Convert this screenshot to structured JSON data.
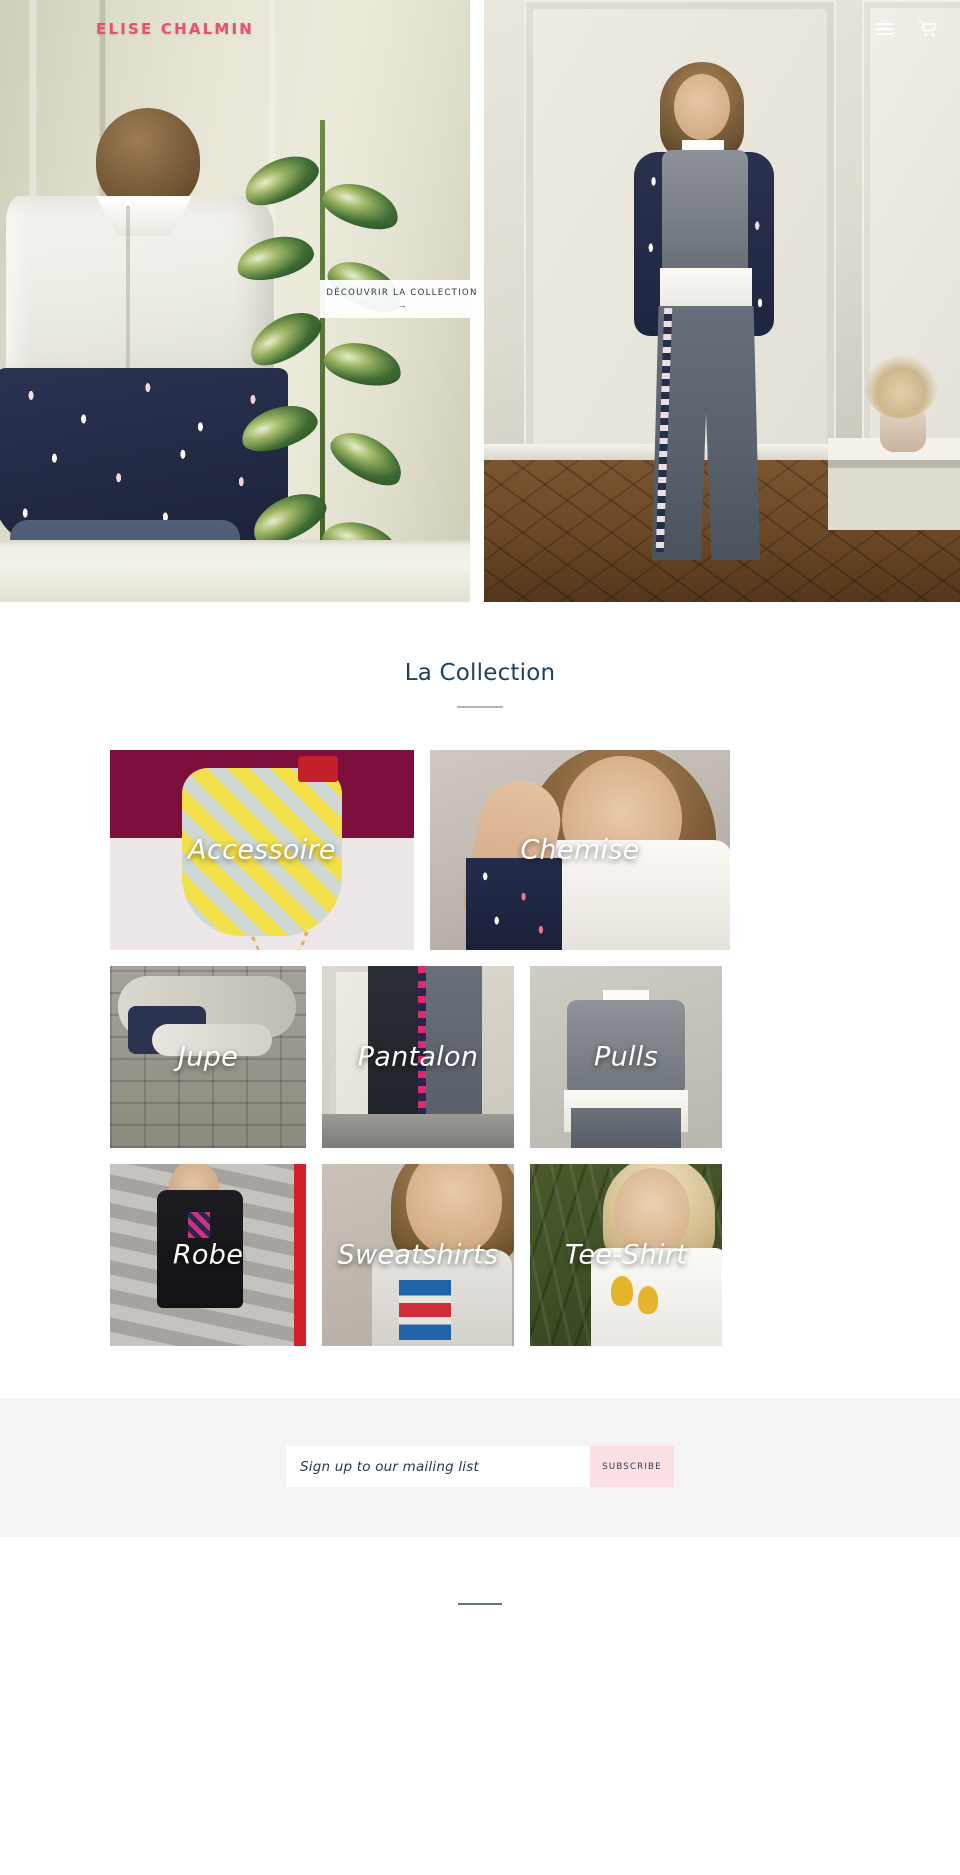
{
  "header": {
    "brand": "ELISE CHALMIN",
    "menu_icon": "hamburger-menu-icon",
    "cart_icon": "shopping-cart-icon"
  },
  "hero": {
    "cta_label": "DÉCOUVRIR LA COLLECTION",
    "cta_arrow": "→",
    "slides": [
      {
        "alt": "Woman from behind wearing white and navy print blouse beside a plant"
      },
      {
        "alt": "Model standing in a room wearing grey vest and wide grey trousers"
      }
    ]
  },
  "collection": {
    "title": "La Collection",
    "tiles": [
      {
        "label": "Accessoire"
      },
      {
        "label": "Chemise"
      },
      {
        "label": "Jupe"
      },
      {
        "label": "Pantalon"
      },
      {
        "label": "Pulls"
      },
      {
        "label": "Robe"
      },
      {
        "label": "Sweatshirts"
      },
      {
        "label": "Tee-Shirt"
      }
    ]
  },
  "newsletter": {
    "placeholder": "Sign up to our mailing list",
    "value": "",
    "subscribe_label": "SUBSCRIBE"
  },
  "colors": {
    "brand_pink": "#e8506b",
    "heading_navy": "#21405a",
    "subscribe_bg": "#fbdfe2",
    "newsletter_bg": "#f4f4f4",
    "rule": "#a9b7bd"
  }
}
